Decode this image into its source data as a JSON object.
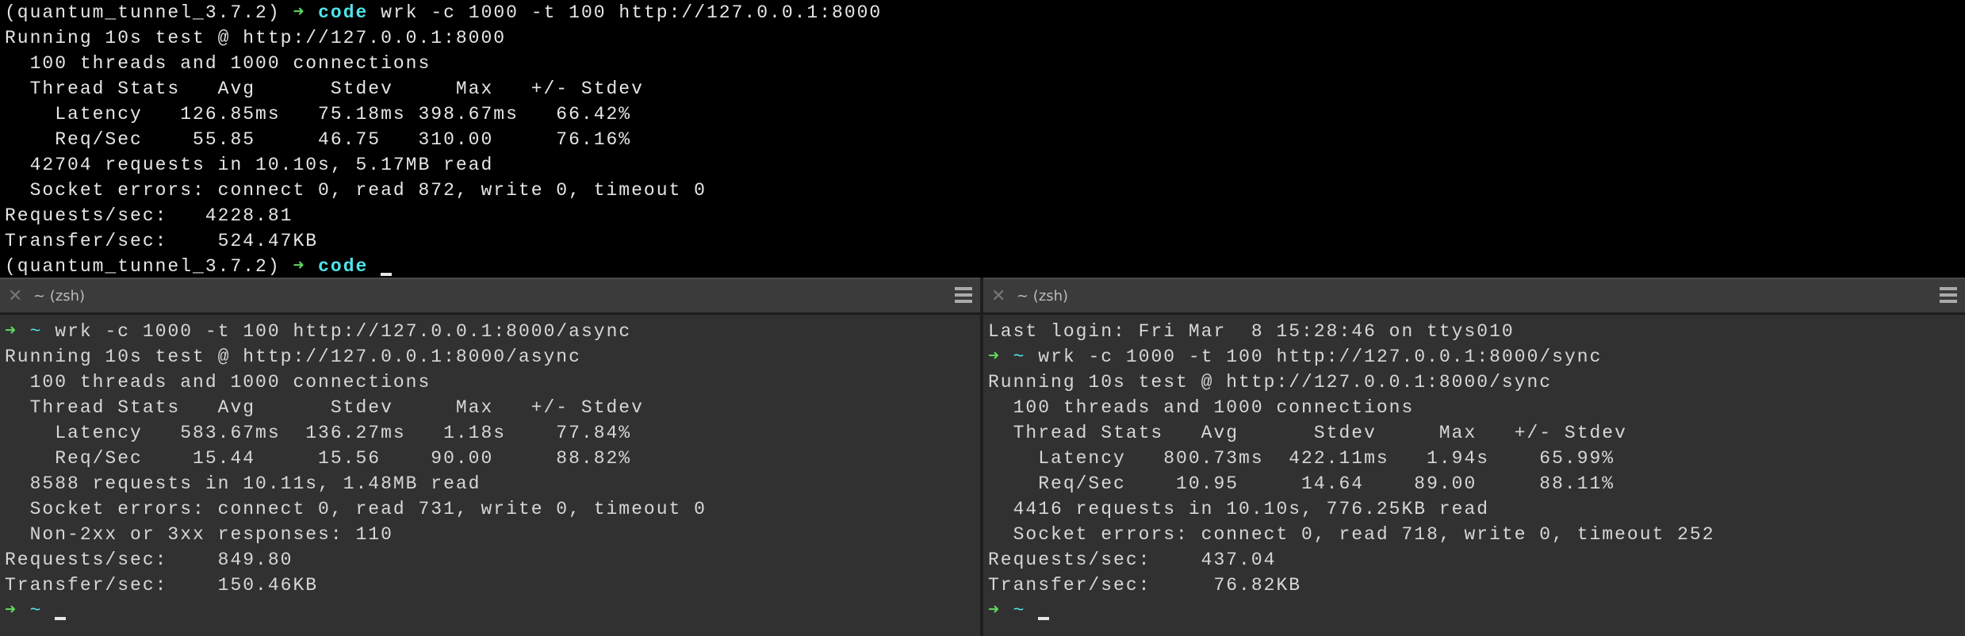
{
  "colors": {
    "prompt_arrow": "#5fd75f",
    "directory": "#4fe3ea",
    "top_bg": "#000000",
    "pane_bg": "#313131"
  },
  "panes": {
    "top": {
      "lines": [
        {
          "type": "prompt",
          "env": "(quantum_tunnel_3.7.2) ",
          "arrow": "➜",
          "dir": "code",
          "cmd": " wrk -c 1000 -t 100 http://127.0.0.1:8000"
        },
        {
          "type": "text",
          "text": "Running 10s test @ http://127.0.0.1:8000"
        },
        {
          "type": "text",
          "text": "  100 threads and 1000 connections"
        },
        {
          "type": "text",
          "text": "  Thread Stats   Avg      Stdev     Max   +/- Stdev"
        },
        {
          "type": "text",
          "text": "    Latency   126.85ms   75.18ms 398.67ms   66.42%"
        },
        {
          "type": "text",
          "text": "    Req/Sec    55.85     46.75   310.00     76.16%"
        },
        {
          "type": "text",
          "text": "  42704 requests in 10.10s, 5.17MB read"
        },
        {
          "type": "text",
          "text": "  Socket errors: connect 0, read 872, write 0, timeout 0"
        },
        {
          "type": "text",
          "text": "Requests/sec:   4228.81"
        },
        {
          "type": "text",
          "text": "Transfer/sec:    524.47KB"
        },
        {
          "type": "prompt",
          "env": "(quantum_tunnel_3.7.2) ",
          "arrow": "➜",
          "dir": "code",
          "cmd": " ",
          "cursor": true
        }
      ]
    },
    "left": {
      "tab": {
        "close_icon": "✕",
        "title": "~ (zsh)",
        "menu_icon": "hamburger-menu"
      },
      "lines": [
        {
          "type": "prompt",
          "env": "",
          "arrow": "➜",
          "dir": "~",
          "cmd": " wrk -c 1000 -t 100 http://127.0.0.1:8000/async"
        },
        {
          "type": "text",
          "text": "Running 10s test @ http://127.0.0.1:8000/async"
        },
        {
          "type": "text",
          "text": "  100 threads and 1000 connections"
        },
        {
          "type": "text",
          "text": "  Thread Stats   Avg      Stdev     Max   +/- Stdev"
        },
        {
          "type": "text",
          "text": "    Latency   583.67ms  136.27ms   1.18s    77.84%"
        },
        {
          "type": "text",
          "text": "    Req/Sec    15.44     15.56    90.00     88.82%"
        },
        {
          "type": "text",
          "text": "  8588 requests in 10.11s, 1.48MB read"
        },
        {
          "type": "text",
          "text": "  Socket errors: connect 0, read 731, write 0, timeout 0"
        },
        {
          "type": "text",
          "text": "  Non-2xx or 3xx responses: 110"
        },
        {
          "type": "text",
          "text": "Requests/sec:    849.80"
        },
        {
          "type": "text",
          "text": "Transfer/sec:    150.46KB"
        },
        {
          "type": "prompt",
          "env": "",
          "arrow": "➜",
          "dir": "~",
          "cmd": " ",
          "cursor": true
        }
      ]
    },
    "right": {
      "tab": {
        "close_icon": "✕",
        "title": "~ (zsh)",
        "menu_icon": "hamburger-menu"
      },
      "lines": [
        {
          "type": "text",
          "text": "Last login: Fri Mar  8 15:28:46 on ttys010"
        },
        {
          "type": "prompt",
          "env": "",
          "arrow": "➜",
          "dir": "~",
          "cmd": " wrk -c 1000 -t 100 http://127.0.0.1:8000/sync"
        },
        {
          "type": "text",
          "text": "Running 10s test @ http://127.0.0.1:8000/sync"
        },
        {
          "type": "text",
          "text": "  100 threads and 1000 connections"
        },
        {
          "type": "text",
          "text": "  Thread Stats   Avg      Stdev     Max   +/- Stdev"
        },
        {
          "type": "text",
          "text": "    Latency   800.73ms  422.11ms   1.94s    65.99%"
        },
        {
          "type": "text",
          "text": "    Req/Sec    10.95     14.64    89.00     88.11%"
        },
        {
          "type": "text",
          "text": "  4416 requests in 10.10s, 776.25KB read"
        },
        {
          "type": "text",
          "text": "  Socket errors: connect 0, read 718, write 0, timeout 252"
        },
        {
          "type": "text",
          "text": "Requests/sec:    437.04"
        },
        {
          "type": "text",
          "text": "Transfer/sec:     76.82KB"
        },
        {
          "type": "prompt",
          "env": "",
          "arrow": "➜",
          "dir": "~",
          "cmd": " ",
          "cursor": true
        }
      ]
    }
  }
}
